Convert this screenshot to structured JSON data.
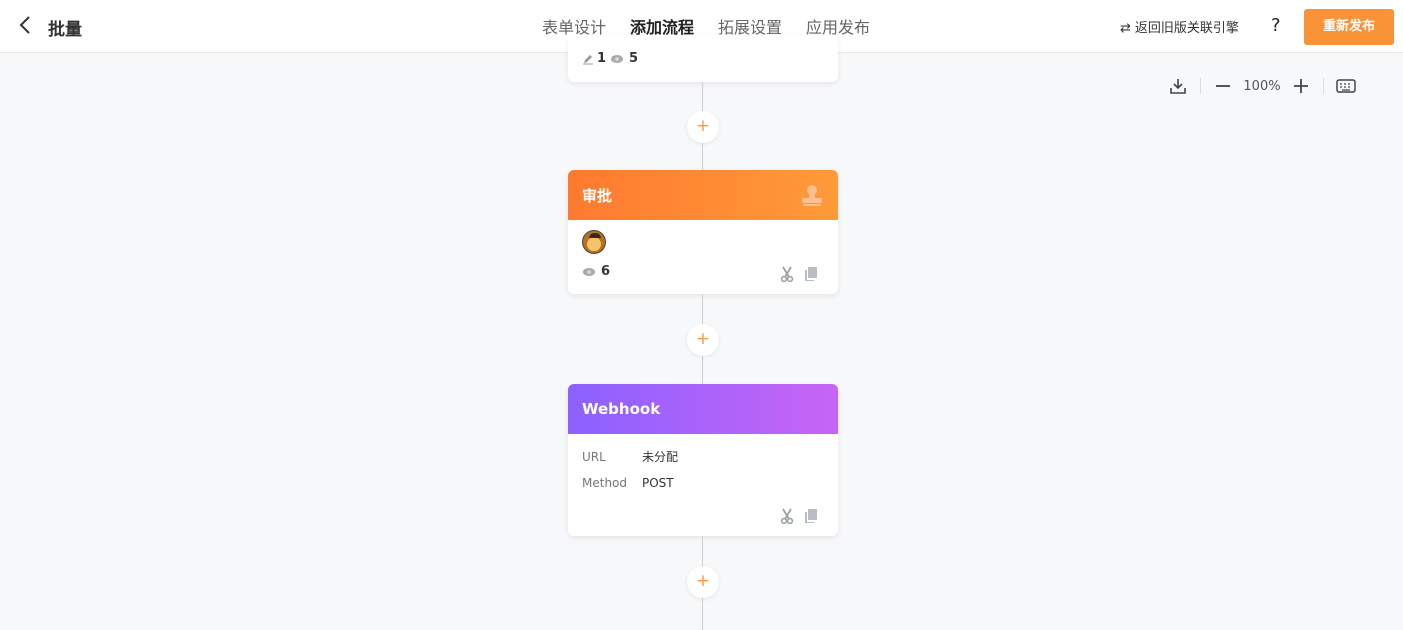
{
  "header": {
    "title": "批量",
    "tabs": [
      {
        "label": "表单设计",
        "active": false
      },
      {
        "label": "添加流程",
        "active": true
      },
      {
        "label": "拓展设置",
        "active": false
      },
      {
        "label": "应用发布",
        "active": false
      }
    ],
    "legacy_link": "返回旧版关联引擎",
    "help": "?",
    "publish_label": "重新发布"
  },
  "toolbar": {
    "zoom": "100%"
  },
  "colors": {
    "accent": "#fa9237",
    "approval_head": "#ff7a30",
    "webhook_head": "#8b62ff"
  },
  "top_node": {
    "edit_count": "1",
    "view_count": "5"
  },
  "approval_node": {
    "title": "审批",
    "view_count": "6"
  },
  "webhook_node": {
    "title": "Webhook",
    "rows": [
      {
        "key": "URL",
        "value": "未分配"
      },
      {
        "key": "Method",
        "value": "POST"
      }
    ]
  },
  "add_symbol": "+"
}
